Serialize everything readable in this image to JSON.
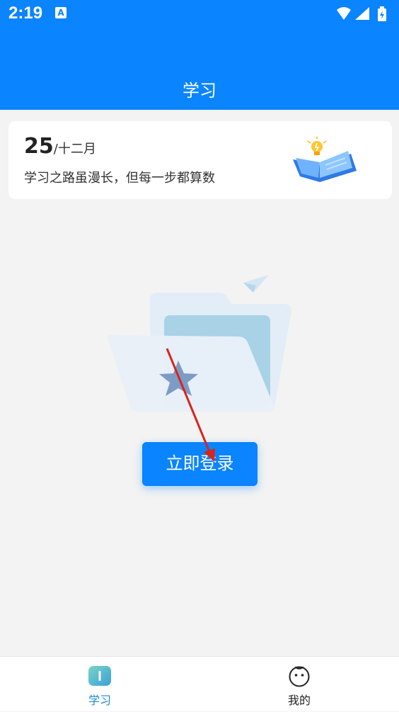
{
  "status_bar": {
    "time": "2:19",
    "notification_icon": "A",
    "icons": [
      "wifi-icon",
      "signal-icon",
      "battery-icon"
    ]
  },
  "header": {
    "title": "学习"
  },
  "date_card": {
    "day": "25",
    "month_separator": "/",
    "month": "十二月",
    "motto": "学习之路虽漫长，但每一步都算数"
  },
  "main": {
    "login_button_label": "立即登录"
  },
  "bottom_nav": {
    "items": [
      {
        "label": "学习",
        "icon": "study-icon",
        "active": true
      },
      {
        "label": "我的",
        "icon": "face-icon",
        "active": false
      }
    ]
  },
  "colors": {
    "primary": "#0a84ff",
    "active_tab": "#1a8bd1",
    "background": "#f3f3f3"
  }
}
